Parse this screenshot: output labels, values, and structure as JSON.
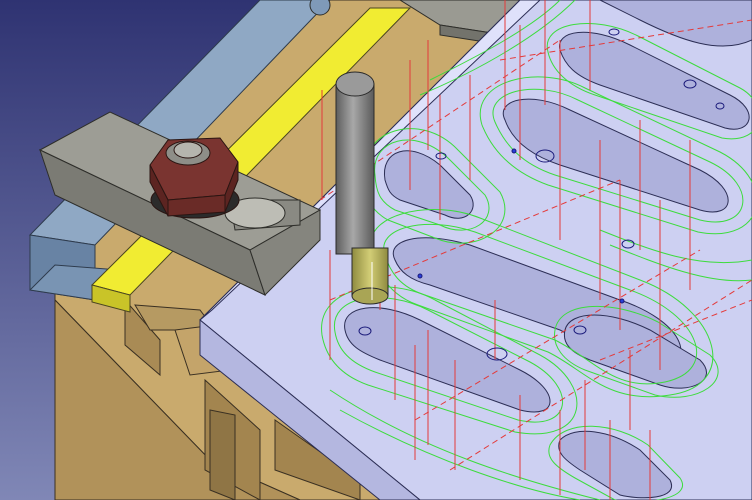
{
  "viewport": {
    "background_top": "#2f3372",
    "background_bottom": "#7f86b4",
    "colors": {
      "fixture_tan": "#c8a86c",
      "fixture_tan_dark": "#a98b55",
      "clamp_gray": "#9a9a92",
      "clamp_gray_dark": "#6f6f69",
      "nut_red": "#7a3430",
      "rail_blue": "#7f9ab8",
      "yellow_strip": "#f1ec32",
      "part_lavender": "#cbcdf0",
      "part_lavender_dark": "#aeb1dc",
      "toolpath_green": "#3ddc3d",
      "toolpath_red": "#e43a3a",
      "tool_gray": "#7d7d7d",
      "tool_tip_yellow": "#b7b35b",
      "point_blue": "#2233cc"
    }
  }
}
